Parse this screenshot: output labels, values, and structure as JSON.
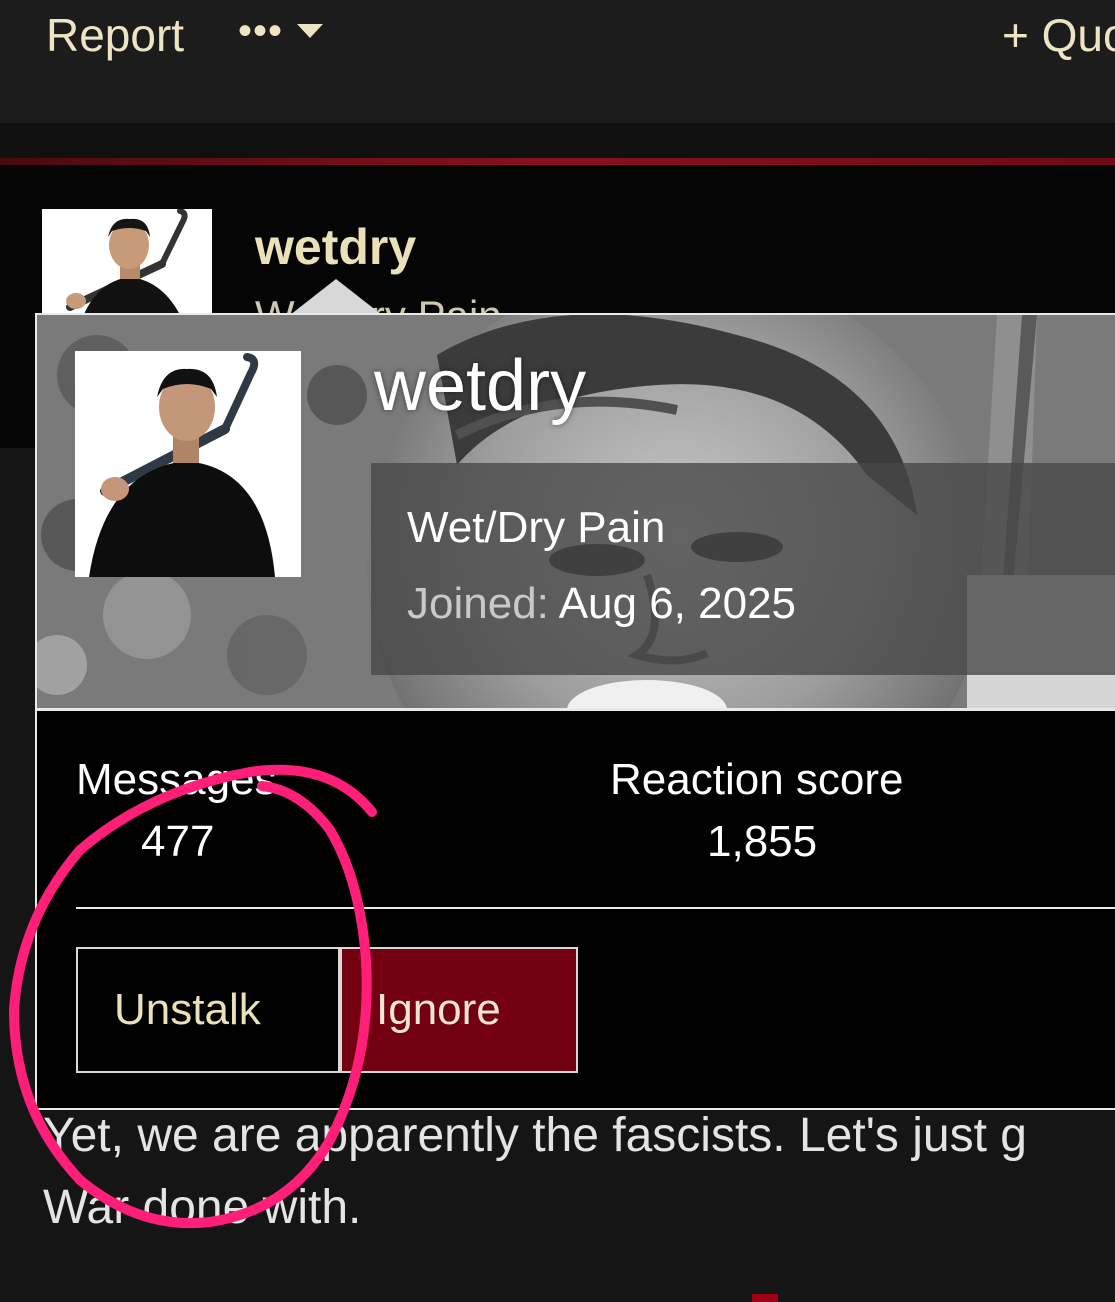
{
  "toolbar": {
    "report_label": "Report",
    "more_label": "•••",
    "quote_label": "+ Quo"
  },
  "post": {
    "username": "wetdry",
    "user_title_clipped": "Wet/Dry Pain",
    "body_line1": "Yet, we are apparently the fascists. Let's just g",
    "body_line2": "War done with."
  },
  "member_card": {
    "username": "wetdry",
    "user_title": "Wet/Dry Pain",
    "joined_label": "Joined:",
    "joined_date": "Aug 6, 2025",
    "stats": {
      "messages_label": "Messages",
      "messages_value": "477",
      "reaction_label": "Reaction score",
      "reaction_value": "1,855"
    },
    "buttons": {
      "unstalk": "Unstalk",
      "ignore": "Ignore"
    }
  },
  "colors": {
    "accent_red": "#720010",
    "annotation_pink": "#ff1e78",
    "text_cream": "#ebe1b8"
  },
  "icons": [
    "ellipsis-icon",
    "chevron-down-icon",
    "plus-icon"
  ]
}
